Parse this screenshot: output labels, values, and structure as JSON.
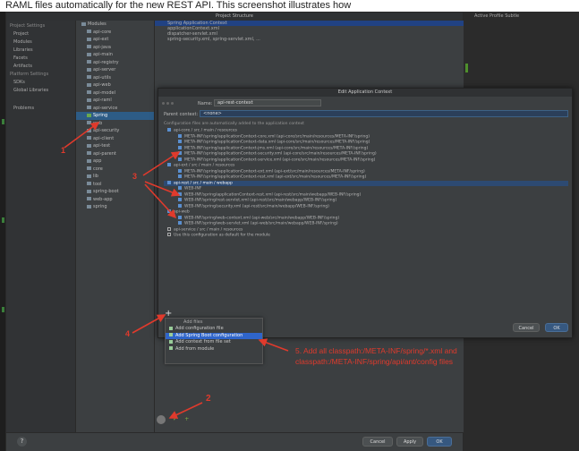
{
  "caption": "RAML files automatically for the new REST API. This screenshot illustrates how",
  "right_panel": {
    "tip": "Active Profile Subtle"
  },
  "window": {
    "title": "Project Structure"
  },
  "sidebar": {
    "items": [
      "Project Settings",
      "Project",
      "Modules",
      "Libraries",
      "Facets",
      "Artifacts",
      "Platform Settings",
      "SDKs",
      "Global Libraries",
      "",
      "Problems"
    ]
  },
  "tree": {
    "rows": [
      {
        "label": "Modules"
      },
      {
        "label": "api-core"
      },
      {
        "label": "api-ext"
      },
      {
        "label": "api-java"
      },
      {
        "label": "api-main"
      },
      {
        "label": "api-registry"
      },
      {
        "label": "api-server"
      },
      {
        "label": "api-utils"
      },
      {
        "label": "api-web"
      },
      {
        "label": "api-model"
      },
      {
        "label": "api-raml"
      },
      {
        "label": "api-service"
      },
      {
        "label": "Spring",
        "selected": true
      },
      {
        "label": "web"
      },
      {
        "label": "api-security"
      },
      {
        "label": "api-client"
      },
      {
        "label": "api-test"
      },
      {
        "label": "api-parent"
      },
      {
        "label": "app"
      },
      {
        "label": "core"
      },
      {
        "label": "lib"
      },
      {
        "label": "tool"
      },
      {
        "label": "spring-boot"
      },
      {
        "label": "web-app"
      },
      {
        "label": "spring"
      }
    ]
  },
  "main_lines": [
    "Spring Application Context",
    "  applicationContext.xml",
    "  dispatcher-servlet.xml",
    "  spring-security.xml, spring-servlet.xml, ..."
  ],
  "dialog": {
    "title": "Edit Application Context",
    "name_label": "Name:",
    "name_value": "api-rest-context",
    "parent_label": "Parent context:",
    "parent_value": "<none>",
    "hint": "Configuration files are automatically added to the application context",
    "lines": [
      {
        "text": "api-core / src / main / resources",
        "checked": true,
        "hl": false
      },
      {
        "text": "META-INF/spring/applicationContext-core.xml (api-core/src/main/resources/META-INF/spring)",
        "checked": true,
        "hl": false
      },
      {
        "text": "META-INF/spring/applicationContext-data.xml (api-core/src/main/resources/META-INF/spring)",
        "checked": true,
        "hl": false
      },
      {
        "text": "META-INF/spring/applicationContext-jms.xml (api-core/src/main/resources/META-INF/spring)",
        "checked": true,
        "hl": false
      },
      {
        "text": "META-INF/spring/applicationContext-security.xml (api-core/src/main/resources/META-INF/spring)",
        "checked": true,
        "hl": false
      },
      {
        "text": "META-INF/spring/applicationContext-service.xml (api-core/src/main/resources/META-INF/spring)",
        "checked": true,
        "hl": false
      },
      {
        "text": "api-ext / src / main / resources",
        "checked": true,
        "hl": false
      },
      {
        "text": "META-INF/spring/applicationContext-ext.xml (api-ext/src/main/resources/META-INF/spring)",
        "checked": true,
        "hl": false
      },
      {
        "text": "META-INF/spring/applicationContext-rest.xml (api-ext/src/main/resources/META-INF/spring)",
        "checked": true,
        "hl": false
      },
      {
        "text": "api-rest / src / main / webapp",
        "checked": true,
        "hl": true
      },
      {
        "text": "WEB-INF",
        "checked": true,
        "hl": false
      },
      {
        "text": "WEB-INF/spring/applicationContext-rest.xml (api-rest/src/main/webapp/WEB-INF/spring)",
        "checked": true,
        "hl": false
      },
      {
        "text": "WEB-INF/spring/rest-servlet.xml (api-rest/src/main/webapp/WEB-INF/spring)",
        "checked": true,
        "hl": false
      },
      {
        "text": "WEB-INF/spring/security.xml (api-rest/src/main/webapp/WEB-INF/spring)",
        "checked": true,
        "hl": false
      },
      {
        "text": "api-web",
        "checked": true,
        "hl": false
      },
      {
        "text": "WEB-INF/spring/web-context.xml (api-web/src/main/webapp/WEB-INF/spring)",
        "checked": true,
        "hl": false
      },
      {
        "text": "WEB-INF/spring/web-servlet.xml (api-web/src/main/webapp/WEB-INF/spring)",
        "checked": true,
        "hl": false
      },
      {
        "text": "api-service / src / main / resources",
        "checked": false,
        "hl": false
      },
      {
        "text": "Use this configuration as default for the module",
        "checked": false,
        "hl": false
      }
    ],
    "cancel": "Cancel",
    "ok": "OK"
  },
  "popup": {
    "header": "Add files",
    "options": [
      {
        "label": "Add configuration file",
        "selected": false
      },
      {
        "label": "Add Spring Boot configuration",
        "selected": true
      },
      {
        "label": "Add context from file set",
        "selected": false
      },
      {
        "label": "Add from module",
        "selected": false
      }
    ]
  },
  "footer": {
    "cancel": "Cancel",
    "apply": "Apply",
    "ok": "OK",
    "help": "?"
  },
  "annotations": {
    "n1": "1",
    "n2": "2",
    "n3": "3",
    "n4": "4",
    "n5": "5. Add all classpath:/META-INF/spring/*.xml and\nclasspath:/META-INF/spring/api/ant/config files"
  },
  "colors": {
    "annotation": "#e03a2c",
    "selection": "#2f65ca"
  }
}
